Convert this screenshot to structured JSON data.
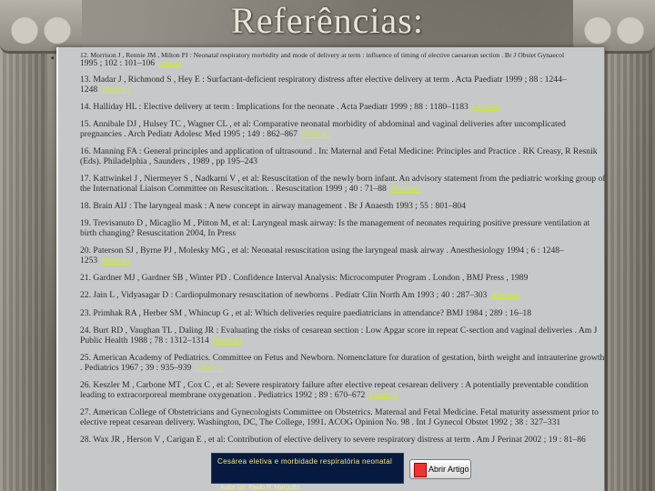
{
  "title": "Referências:",
  "references": [
    {
      "text": "12. Morrison J , Rennie JM , Milton PJ : Neonatal respiratory morbidity and mode of delivery at term : influence of timing of elective caesarean section . Br J Obstet Gynaecol",
      "tail": "1995 ; 102 : 101–106",
      "link": "Abstract"
    },
    {
      "text": "13. Madar J , Richmond S , Hey E : Surfactant-deficient respiratory distress after elective delivery at term . Acta Paediatr 1999 ; 88 : 1244–1248",
      "link": "Abstract"
    },
    {
      "text": "14. Halliday HL : Elective delivery at term : Implications for the neonate . Acta Paediatr 1999 ; 88 : 1180–1183",
      "link": "Citation"
    },
    {
      "text": "15. Annibale DJ , Hulsey TC , Wagner CL , et al: Comparative neonatal morbidity of abdominal and vaginal deliveries after uncomplicated pregnancies . Arch Pediatr Adolesc Med 1995 ; 149 : 862–867",
      "link": "Abstract"
    },
    {
      "text": "16. Manning FA : General principles and application of ultrasound . In: Maternal and Fetal Medicine: Principles and Practice . RK Creasy, R Resnik (Eds). Philadelphia , Saunders , 1989 , pp 195–243",
      "link": ""
    },
    {
      "text": "17. Kattwinkel J , Niermeyer S , Nadkarni V , et al: Resuscitation of the newly born infant. An advisory statement from the pediatric working group of the International Liaison Committee on Resuscitation. . Resuscitation 1999 ; 40 : 71–88",
      "link": "Abstract"
    },
    {
      "text": "18. Brain AIJ : The laryngeal mask : A new concept in airway management . Br J Anaesth 1993 ; 55 : 801–804",
      "link": ""
    },
    {
      "text": "19. Trevisanuto D , Micaglio M , Pitton M, et al: Laryngeal mask airway: Is the management of neonates requiring positive pressure ventilation at birth changing? Resuscitation 2004, In Press",
      "link": ""
    },
    {
      "text": "20. Paterson SJ , Byrne PJ , Molesky MG , et al: Neonatal resuscitation using the laryngeal mask airway . Anesthesiology 1994 ; 6 : 1248–1253",
      "link": "Abstract"
    },
    {
      "text": "21. Gardner MJ , Gardner SB , Winter PD . Confidence Interval Analysis: Microcomputer Program . London , BMJ Press , 1989",
      "link": ""
    },
    {
      "text": "22. Jain L , Vidyasagar D : Cardiopulmonary resuscitation of newborns . Pediatr Clin North Am 1993 ; 40 : 287–303",
      "link": "Abstract"
    },
    {
      "text": "23. Primhak RA , Herber SM , Whincup G , et al: Which deliveries require paediatricians in attendance? BMJ 1984 ; 289 : 16–18",
      "link": ""
    },
    {
      "text": "24. Burt RD , Vaughan TL , Daling JR : Evaluating the risks of cesarean section : Low Apgar score in repeat C-section and vaginal deliveries . Am J Public Health 1988 ; 78 : 1312–1314",
      "link": "Abstract"
    },
    {
      "text": "25. American Academy of Pediatrics. Committee on Fetus and Newborn. Nomenclature for duration of gestation, birth weight and intrauterine growth . Pediatrics 1967 ; 39 : 935–939",
      "link": "Citation"
    },
    {
      "text": "26. Keszler M , Carbone MT , Cox C , et al: Severe respiratory failure after elective repeat cesarean delivery : A potentially preventable condition leading to extracorporeal membrane oxygenation . Pediatrics 1992 ; 89 : 670–672",
      "link": "Citation"
    },
    {
      "text": "27. American College of Obstetricians and Gynecologists Committee on Obstetrics. Maternal and Fetal Medicine. Fetal maturity assessment prior to elective repeat cesarean delivery. Washington, DC, The College, 1991. ACOG Opinion No. 98 . Int J Gynecol Obstet 1992 ; 38 : 327–331",
      "link": ""
    },
    {
      "text": "28. Wax JR , Herson V , Carigan E , et al: Contribution of elective delivery to severe respiratory distress at term . Am J Perinat 2002 ; 19 : 81–86",
      "link": ""
    }
  ],
  "video": {
    "title": "Cesárea eletiva e morbidade respiratória neonatal"
  },
  "open_button": {
    "label": "Abrir Artigo"
  },
  "author": "Autor (a): Paulo R. Margotto"
}
